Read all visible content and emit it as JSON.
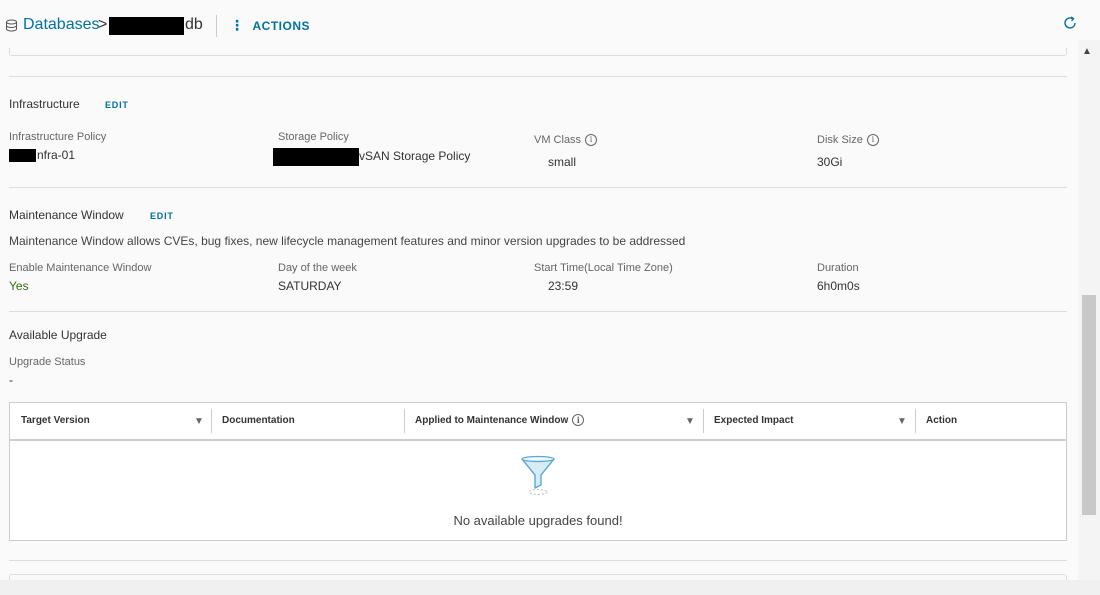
{
  "header": {
    "breadcrumb_root": "Databases",
    "breadcrumb_sep": ">",
    "breadcrumb_suffix": "db",
    "actions_label": "ACTIONS",
    "actions_dots": "⋮"
  },
  "infrastructure": {
    "title": "Infrastructure",
    "edit_label": "EDIT",
    "fields": {
      "infra_policy_label": "Infrastructure Policy",
      "infra_policy_value": "nfra-01",
      "storage_policy_label": "Storage Policy",
      "storage_policy_value": "vSAN Storage Policy",
      "vm_class_label": "VM Class",
      "vm_class_value": "small",
      "disk_size_label": "Disk Size",
      "disk_size_value": "30Gi"
    }
  },
  "maintenance": {
    "title": "Maintenance Window",
    "edit_label": "EDIT",
    "description": "Maintenance Window allows CVEs, bug fixes, new lifecycle management features and minor version upgrades to be addressed",
    "enable_label": "Enable Maintenance Window",
    "enable_value": "Yes",
    "day_label": "Day of the week",
    "day_value": "SATURDAY",
    "start_label": "Start Time(Local Time Zone)",
    "start_value": "23:59",
    "duration_label": "Duration",
    "duration_value": "6h0m0s"
  },
  "upgrade": {
    "title": "Available Upgrade",
    "status_label": "Upgrade Status",
    "status_value": "-",
    "columns": [
      "Target Version",
      "Documentation",
      "Applied to Maintenance Window",
      "Expected Impact",
      "Action"
    ],
    "empty_message": "No available upgrades found!"
  },
  "colors": {
    "link": "#0072a3",
    "yes": "#2f6d0a"
  },
  "icons": [
    "database-icon",
    "refresh-icon",
    "info-icon",
    "filter-icon",
    "empty-funnel-icon",
    "scroll-up-arrow-icon"
  ]
}
